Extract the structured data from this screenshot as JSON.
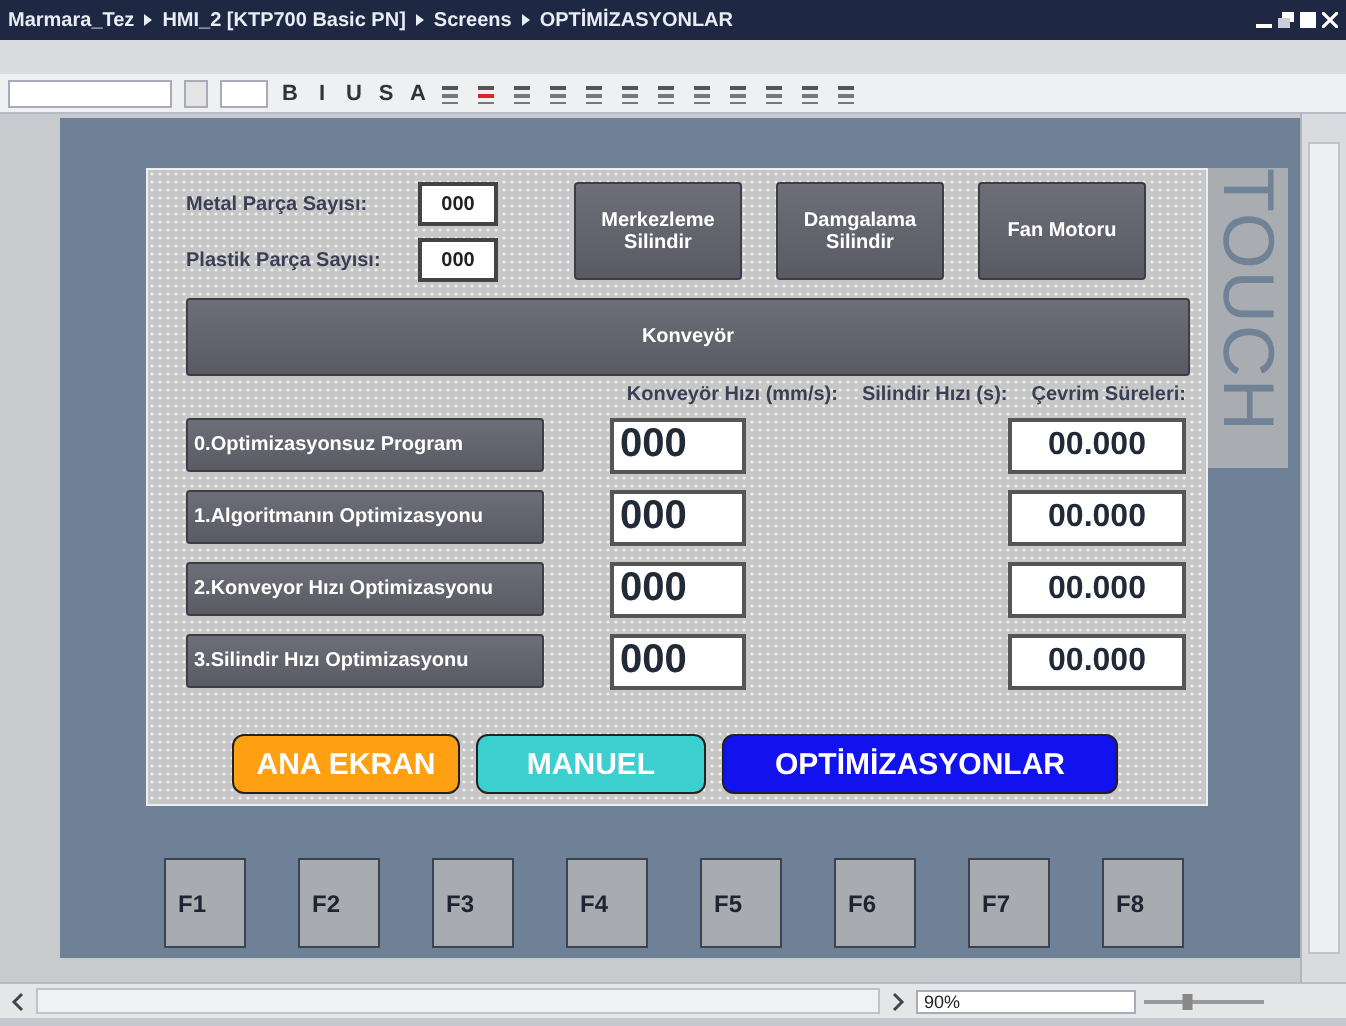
{
  "title_bar": {
    "breadcrumbs": [
      "Marmara_Tez",
      "HMI_2 [KTP700 Basic PN]",
      "Screens",
      "OPTİMİZASYONLAR"
    ]
  },
  "toolbar": {
    "text_buttons": [
      "B",
      "I",
      "U",
      "S",
      "A"
    ]
  },
  "screen": {
    "counters": [
      {
        "label": "Metal Parça Sayısı:",
        "value": "000"
      },
      {
        "label": "Plastik Parça Sayısı:",
        "value": "000"
      }
    ],
    "top_buttons": [
      "Merkezleme Silindir",
      "Damgalama Silindir",
      "Fan Motoru"
    ],
    "conveyor_button": "Konveyör",
    "column_headers": [
      "Konveyör Hızı (mm/s):",
      "Silindir Hızı (s):",
      "Çevrim Süreleri:"
    ],
    "programs": [
      {
        "label": "0.Optimizasyonsuz Program",
        "speed": "000",
        "cycle": "00.000"
      },
      {
        "label": "1.Algoritmanın Optimizasyonu",
        "speed": "000",
        "cycle": "00.000"
      },
      {
        "label": "2.Konveyor Hızı Optimizasyonu",
        "speed": "000",
        "cycle": "00.000"
      },
      {
        "label": "3.Silindir Hızı Optimizasyonu",
        "speed": "000",
        "cycle": "00.000"
      }
    ],
    "nav_buttons": [
      {
        "label": "ANA EKRAN",
        "color": "#ff9f12"
      },
      {
        "label": "MANUEL",
        "color": "#3ccfcf"
      },
      {
        "label": "OPTİMİZASYONLAR",
        "color": "#1212ee"
      }
    ]
  },
  "device": {
    "brand": "TOUCH",
    "function_keys": [
      "F1",
      "F2",
      "F3",
      "F4",
      "F5",
      "F6",
      "F7",
      "F8"
    ]
  },
  "zoom": {
    "value": "90%",
    "level": 0.35
  }
}
